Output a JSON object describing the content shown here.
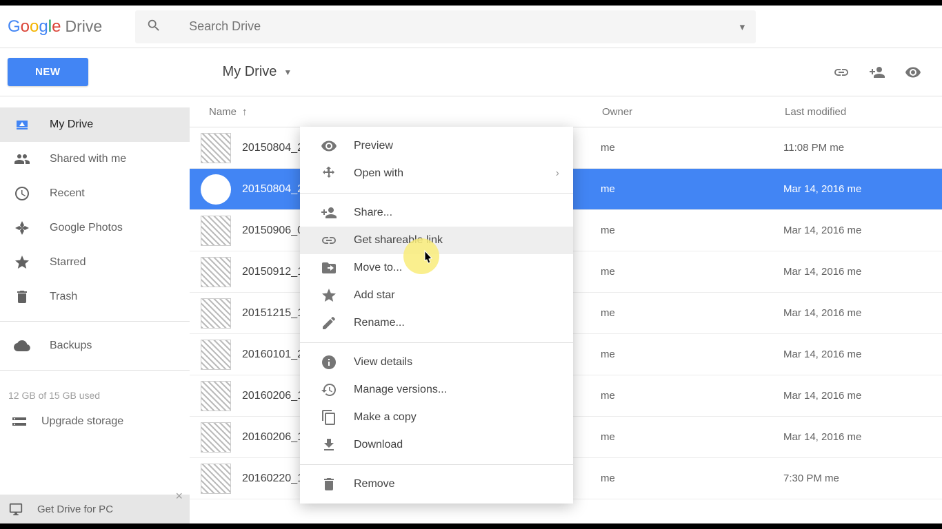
{
  "logo": {
    "google": "Google",
    "product": "Drive"
  },
  "search": {
    "placeholder": "Search Drive"
  },
  "new_button": "NEW",
  "breadcrumb": "My Drive",
  "sidebar": {
    "items": [
      {
        "label": "My Drive",
        "active": true
      },
      {
        "label": "Shared with me"
      },
      {
        "label": "Recent"
      },
      {
        "label": "Google Photos"
      },
      {
        "label": "Starred"
      },
      {
        "label": "Trash"
      }
    ],
    "backups": "Backups",
    "storage": "12 GB of 15 GB used",
    "upgrade": "Upgrade storage",
    "get_drive": "Get Drive for PC"
  },
  "columns": {
    "name": "Name",
    "owner": "Owner",
    "modified": "Last modified"
  },
  "files": [
    {
      "name": "20150804_2",
      "owner": "me",
      "modified": "11:08 PM me",
      "selected": false
    },
    {
      "name": "20150804_2",
      "owner": "me",
      "modified": "Mar 14, 2016 me",
      "selected": true
    },
    {
      "name": "20150906_0",
      "owner": "me",
      "modified": "Mar 14, 2016 me",
      "selected": false
    },
    {
      "name": "20150912_1",
      "owner": "me",
      "modified": "Mar 14, 2016 me",
      "selected": false
    },
    {
      "name": "20151215_1",
      "owner": "me",
      "modified": "Mar 14, 2016 me",
      "selected": false
    },
    {
      "name": "20160101_2",
      "owner": "me",
      "modified": "Mar 14, 2016 me",
      "selected": false
    },
    {
      "name": "20160206_1",
      "owner": "me",
      "modified": "Mar 14, 2016 me",
      "selected": false
    },
    {
      "name": "20160206_1",
      "owner": "me",
      "modified": "Mar 14, 2016 me",
      "selected": false
    },
    {
      "name": "20160220_1",
      "owner": "me",
      "modified": "7:30 PM me",
      "selected": false
    }
  ],
  "context_menu": {
    "preview": "Preview",
    "open_with": "Open with",
    "share": "Share...",
    "get_link": "Get shareable link",
    "move_to": "Move to...",
    "add_star": "Add star",
    "rename": "Rename...",
    "view_details": "View details",
    "manage_versions": "Manage versions...",
    "make_copy": "Make a copy",
    "download": "Download",
    "remove": "Remove"
  }
}
